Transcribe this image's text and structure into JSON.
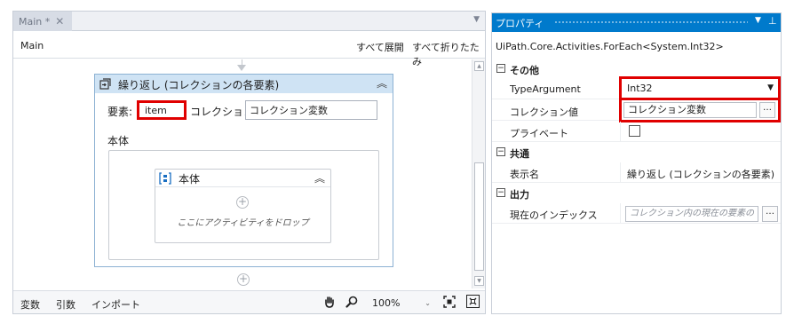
{
  "designer": {
    "tab_label": "Main *",
    "tab_close": "✕",
    "tab_dropdown": "▼",
    "breadcrumb": "Main",
    "expand_all": "すべて展開",
    "collapse_all": "すべて折りたたみ",
    "foreach": {
      "title": "繰り返し (コレクションの各要素)",
      "element_label": "要素:",
      "element_value": "item",
      "collection_label": "コレクション:",
      "collection_value": "コレクション変数",
      "body_label": "本体",
      "sequence": {
        "title": "本体",
        "drop_hint": "ここにアクティビティをドロップ"
      }
    },
    "statusbar": {
      "variables": "変数",
      "arguments": "引数",
      "imports": "インポート",
      "zoom": "100%"
    }
  },
  "properties": {
    "title": "プロパティ",
    "type_name": "UiPath.Core.Activities.ForEach<System.Int32>",
    "categories": [
      {
        "label": "その他",
        "items": [
          {
            "name": "TypeArgument",
            "value": "Int32"
          },
          {
            "name": "コレクション値",
            "value": "コレクション変数"
          },
          {
            "name": "プライベート",
            "value": ""
          }
        ]
      },
      {
        "label": "共通",
        "items": [
          {
            "name": "表示名",
            "value": "繰り返し (コレクションの各要素)"
          }
        ]
      },
      {
        "label": "出力",
        "items": [
          {
            "name": "現在のインデックス",
            "placeholder": "コレクション内の現在の要素の"
          }
        ]
      }
    ]
  },
  "colors": {
    "accent": "#007acc",
    "highlight": "#e00000",
    "activity_header": "#cfe3f4"
  }
}
